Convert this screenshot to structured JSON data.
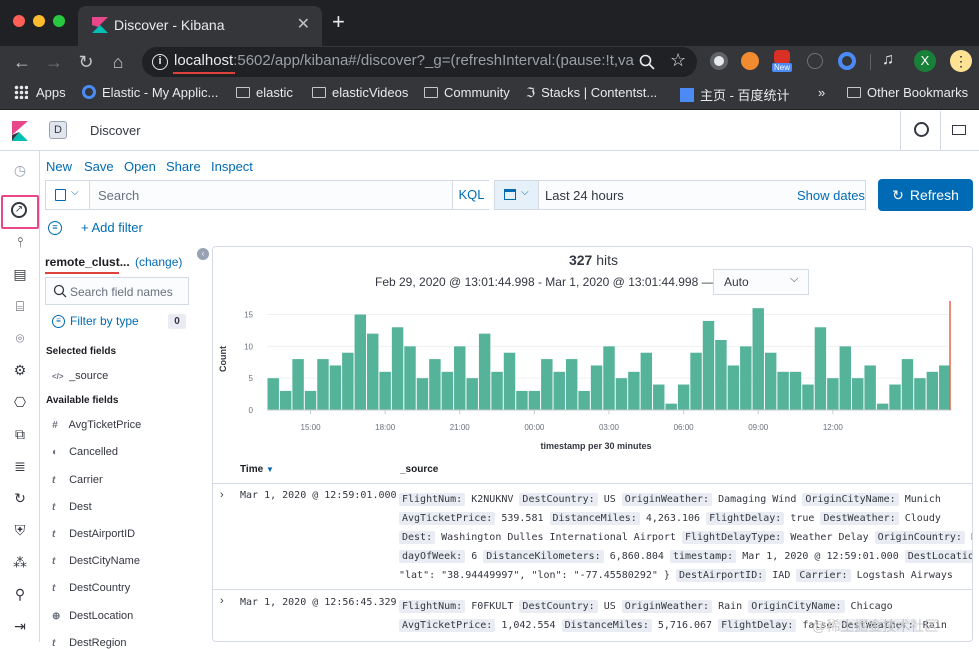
{
  "browser": {
    "tab_title": "Discover - Kibana",
    "tab_close": "✕",
    "new_tab": "+",
    "url_host": "localhost",
    "url_rest": ":5602/app/kibana#/discover?_g=(refreshInterval:(pause:!t,val...",
    "info_icon": "i",
    "bookmarks": [
      {
        "label": "Apps"
      },
      {
        "label": "Elastic - My Applic..."
      },
      {
        "label": "elastic"
      },
      {
        "label": "elasticVideos"
      },
      {
        "label": "Community"
      },
      {
        "label": "Stacks | Contentst..."
      },
      {
        "label": "主页 - 百度统计"
      },
      {
        "label": "»"
      },
      {
        "label": "Other Bookmarks"
      }
    ],
    "ext_new_badge": "New",
    "profile_initial": "X"
  },
  "kibana": {
    "space_initial": "D",
    "app_title": "Discover",
    "menu": [
      "New",
      "Save",
      "Open",
      "Share",
      "Inspect"
    ],
    "search_placeholder": "Search",
    "kql_label": "KQL",
    "time_range": "Last 24 hours",
    "show_dates": "Show dates",
    "refresh_label": "Refresh",
    "add_filter": "+ Add filter",
    "index_pattern": "remote_clust...",
    "change_link": "(change)",
    "field_search_placeholder": "Search field names",
    "filter_by_type": "Filter by type",
    "filter_count": "0",
    "selected_fields_title": "Selected fields",
    "selected_fields": [
      {
        "type": "</>",
        "name": "_source"
      }
    ],
    "available_fields_title": "Available fields",
    "available_fields": [
      {
        "type": "#",
        "name": "AvgTicketPrice"
      },
      {
        "type": "◐",
        "name": "Cancelled"
      },
      {
        "type": "t",
        "name": "Carrier"
      },
      {
        "type": "t",
        "name": "Dest"
      },
      {
        "type": "t",
        "name": "DestAirportID"
      },
      {
        "type": "t",
        "name": "DestCityName"
      },
      {
        "type": "t",
        "name": "DestCountry"
      },
      {
        "type": "⊕",
        "name": "DestLocation"
      },
      {
        "type": "t",
        "name": "DestRegion"
      }
    ],
    "hits_count": "327",
    "hits_label": "hits",
    "date_range_text": "Feb 29, 2020 @ 13:01:44.998 - Mar 1, 2020 @ 13:01:44.998 —",
    "interval_select": "Auto",
    "table_headers": {
      "time": "Time",
      "source": "_source"
    },
    "documents": [
      {
        "time": "Mar 1, 2020 @ 12:59:01.000",
        "lines": [
          [
            [
              "FlightNum:",
              "K2NUKNV"
            ],
            [
              "DestCountry:",
              "US"
            ],
            [
              "OriginWeather:",
              "Damaging Wind"
            ],
            [
              "OriginCityName:",
              "Munich"
            ]
          ],
          [
            [
              "AvgTicketPrice:",
              "539.581"
            ],
            [
              "DistanceMiles:",
              "4,263.106"
            ],
            [
              "FlightDelay:",
              "true"
            ],
            [
              "DestWeather:",
              "Cloudy"
            ]
          ],
          [
            [
              "Dest:",
              "Washington Dulles International Airport"
            ],
            [
              "FlightDelayType:",
              "Weather Delay"
            ],
            [
              "OriginCountry:",
              "DE"
            ]
          ],
          [
            [
              "dayOfWeek:",
              "6"
            ],
            [
              "DistanceKilometers:",
              "6,860.804"
            ],
            [
              "timestamp:",
              "Mar 1, 2020 @ 12:59:01.000"
            ],
            [
              "DestLocation:",
              "{"
            ]
          ],
          [
            [
              "",
              "\"lat\": \"38.94449997\", \"lon\": \"-77.45580292\" }"
            ],
            [
              "DestAirportID:",
              "IAD"
            ],
            [
              "Carrier:",
              "Logstash Airways"
            ]
          ]
        ]
      },
      {
        "time": "Mar 1, 2020 @ 12:56:45.329",
        "lines": [
          [
            [
              "FlightNum:",
              "F0FKULT"
            ],
            [
              "DestCountry:",
              "US"
            ],
            [
              "OriginWeather:",
              "Rain"
            ],
            [
              "OriginCityName:",
              "Chicago"
            ]
          ],
          [
            [
              "AvgTicketPrice:",
              "1,042.554"
            ],
            [
              "DistanceMiles:",
              "5,716.067"
            ],
            [
              "FlightDelay:",
              "false"
            ],
            [
              "DestWeather:",
              "Rain"
            ]
          ]
        ]
      }
    ]
  },
  "colors": {
    "accent": "#006bb4",
    "bar": "#54b399",
    "brand_pink": "#e8488b"
  },
  "chart_data": {
    "type": "bar",
    "title": "",
    "xlabel": "timestamp per 30 minutes",
    "ylabel": "Count",
    "ylim": [
      0,
      16.5
    ],
    "yticks": [
      0,
      5,
      10,
      15
    ],
    "xticks": [
      "15:00",
      "18:00",
      "21:00",
      "00:00",
      "03:00",
      "06:00",
      "09:00",
      "12:00"
    ],
    "values": [
      5,
      3,
      8,
      3,
      8,
      7,
      9,
      15,
      12,
      6,
      13,
      10,
      5,
      8,
      6,
      10,
      5,
      12,
      6,
      9,
      3,
      3,
      8,
      6,
      8,
      3,
      7,
      10,
      5,
      6,
      9,
      4,
      1,
      4,
      9,
      14,
      11,
      7,
      10,
      16,
      9,
      6,
      6,
      4,
      13,
      5,
      10,
      5,
      7,
      1,
      4,
      8,
      5,
      6,
      7
    ],
    "grid": true
  },
  "watermark": "@稀土掘金技术社区"
}
